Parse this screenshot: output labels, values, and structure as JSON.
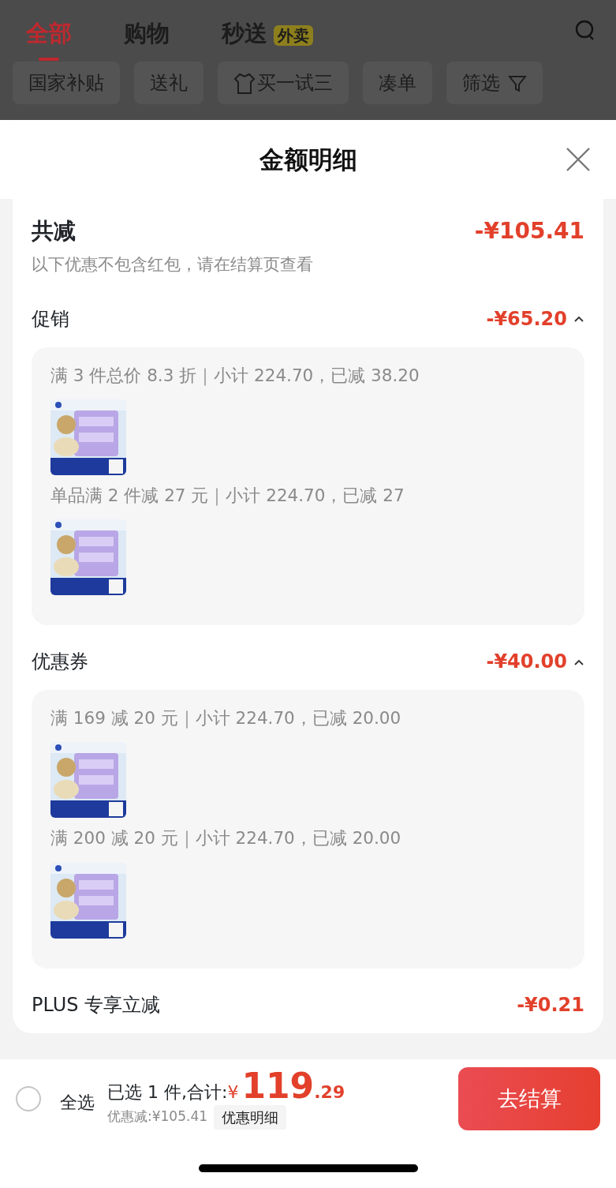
{
  "top_tabs": [
    {
      "label": "全部",
      "selected": true
    },
    {
      "label": "购物",
      "selected": false
    },
    {
      "label": "秒送",
      "selected": false,
      "badge": "外卖"
    }
  ],
  "chips": [
    {
      "label": "国家补贴"
    },
    {
      "label": "送礼"
    },
    {
      "label": "买一试三",
      "kind": "leading-icon"
    },
    {
      "label": "凑单"
    },
    {
      "label": "筛选",
      "kind": "trailing-icon"
    }
  ],
  "sheet": {
    "title": "金额明细",
    "total": {
      "label": "共减",
      "amount": "-¥105.41",
      "note": "以下优惠不包含红包，请在结算页查看"
    },
    "sections": [
      {
        "kind": "group",
        "label": "促销",
        "amount": "-¥65.20",
        "expanded": true,
        "items": [
          {
            "rule": "满 3 件总价 8.3 折｜小计 224.70，已减 38.20",
            "kind": "picture"
          },
          {
            "rule": "单品满 2 件减 27 元｜小计 224.70，已减 27",
            "kind": "picture"
          }
        ]
      },
      {
        "kind": "group",
        "label": "优惠券",
        "amount": "-¥40.00",
        "expanded": true,
        "items": [
          {
            "rule": "满 169 减 20 元｜小计 224.70，已减 20.00",
            "kind": "picture"
          },
          {
            "rule": "满 200 减 20 元｜小计 224.70，已减 20.00",
            "kind": "picture"
          }
        ]
      },
      {
        "kind": "plain",
        "label": "PLUS 专享立减",
        "amount": "-¥0.21"
      }
    ]
  },
  "bottom_bar": {
    "select_all": {
      "label": "全选",
      "checked": false
    },
    "summary": "已选 1 件,合计:",
    "currency": "¥",
    "price_int": "119",
    "price_dec": ".29",
    "discount": "优惠减:¥105.41",
    "detail_link": "优惠明细",
    "checkout": "去结算"
  }
}
